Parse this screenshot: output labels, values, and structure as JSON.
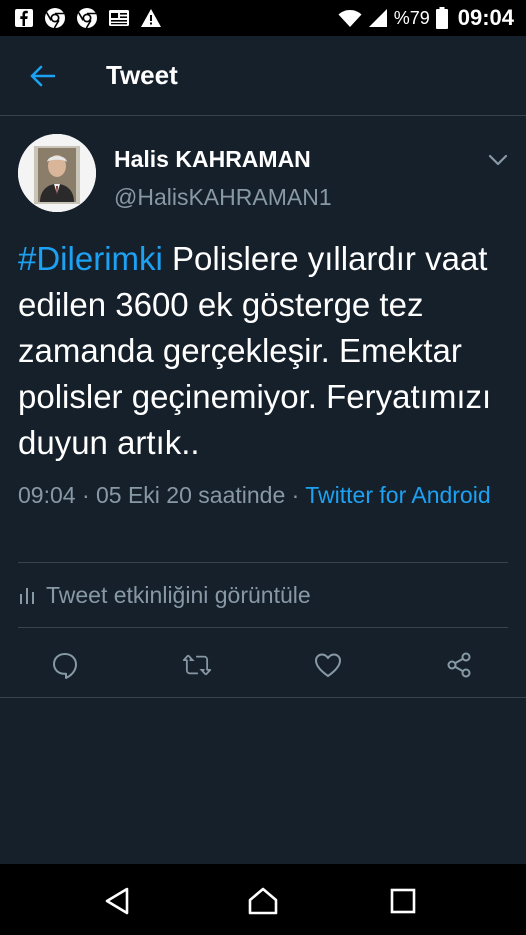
{
  "status_bar": {
    "left_icons": [
      "facebook-icon",
      "chrome-icon",
      "chrome-icon",
      "news-icon",
      "warning-icon"
    ],
    "battery_percent": "%79",
    "time": "09:04"
  },
  "app_bar": {
    "title": "Tweet"
  },
  "tweet": {
    "display_name": "Halis KAHRAMAN",
    "username": "@HalisKAHRAMAN1",
    "hashtag": "#Dilerimki",
    "body": " Polislere yıllardır vaat edilen 3600 ek gösterge tez zamanda gerçekleşir. Emektar polisler geçinemiyor. Feryatımızı duyun artık..",
    "timestamp": "09:04 · 05 Eki 20 saatinde · ",
    "source": "Twitter for Android",
    "activity_label": "Tweet etkinliğini görüntüle"
  },
  "colors": {
    "background": "#15202b",
    "accent": "#1da1f2",
    "secondary_text": "#8899a6",
    "divider": "#38444d"
  },
  "actions": [
    "reply-icon",
    "retweet-icon",
    "like-icon",
    "share-icon"
  ],
  "nav_bar": [
    "back-triangle-icon",
    "home-icon",
    "recents-icon"
  ]
}
